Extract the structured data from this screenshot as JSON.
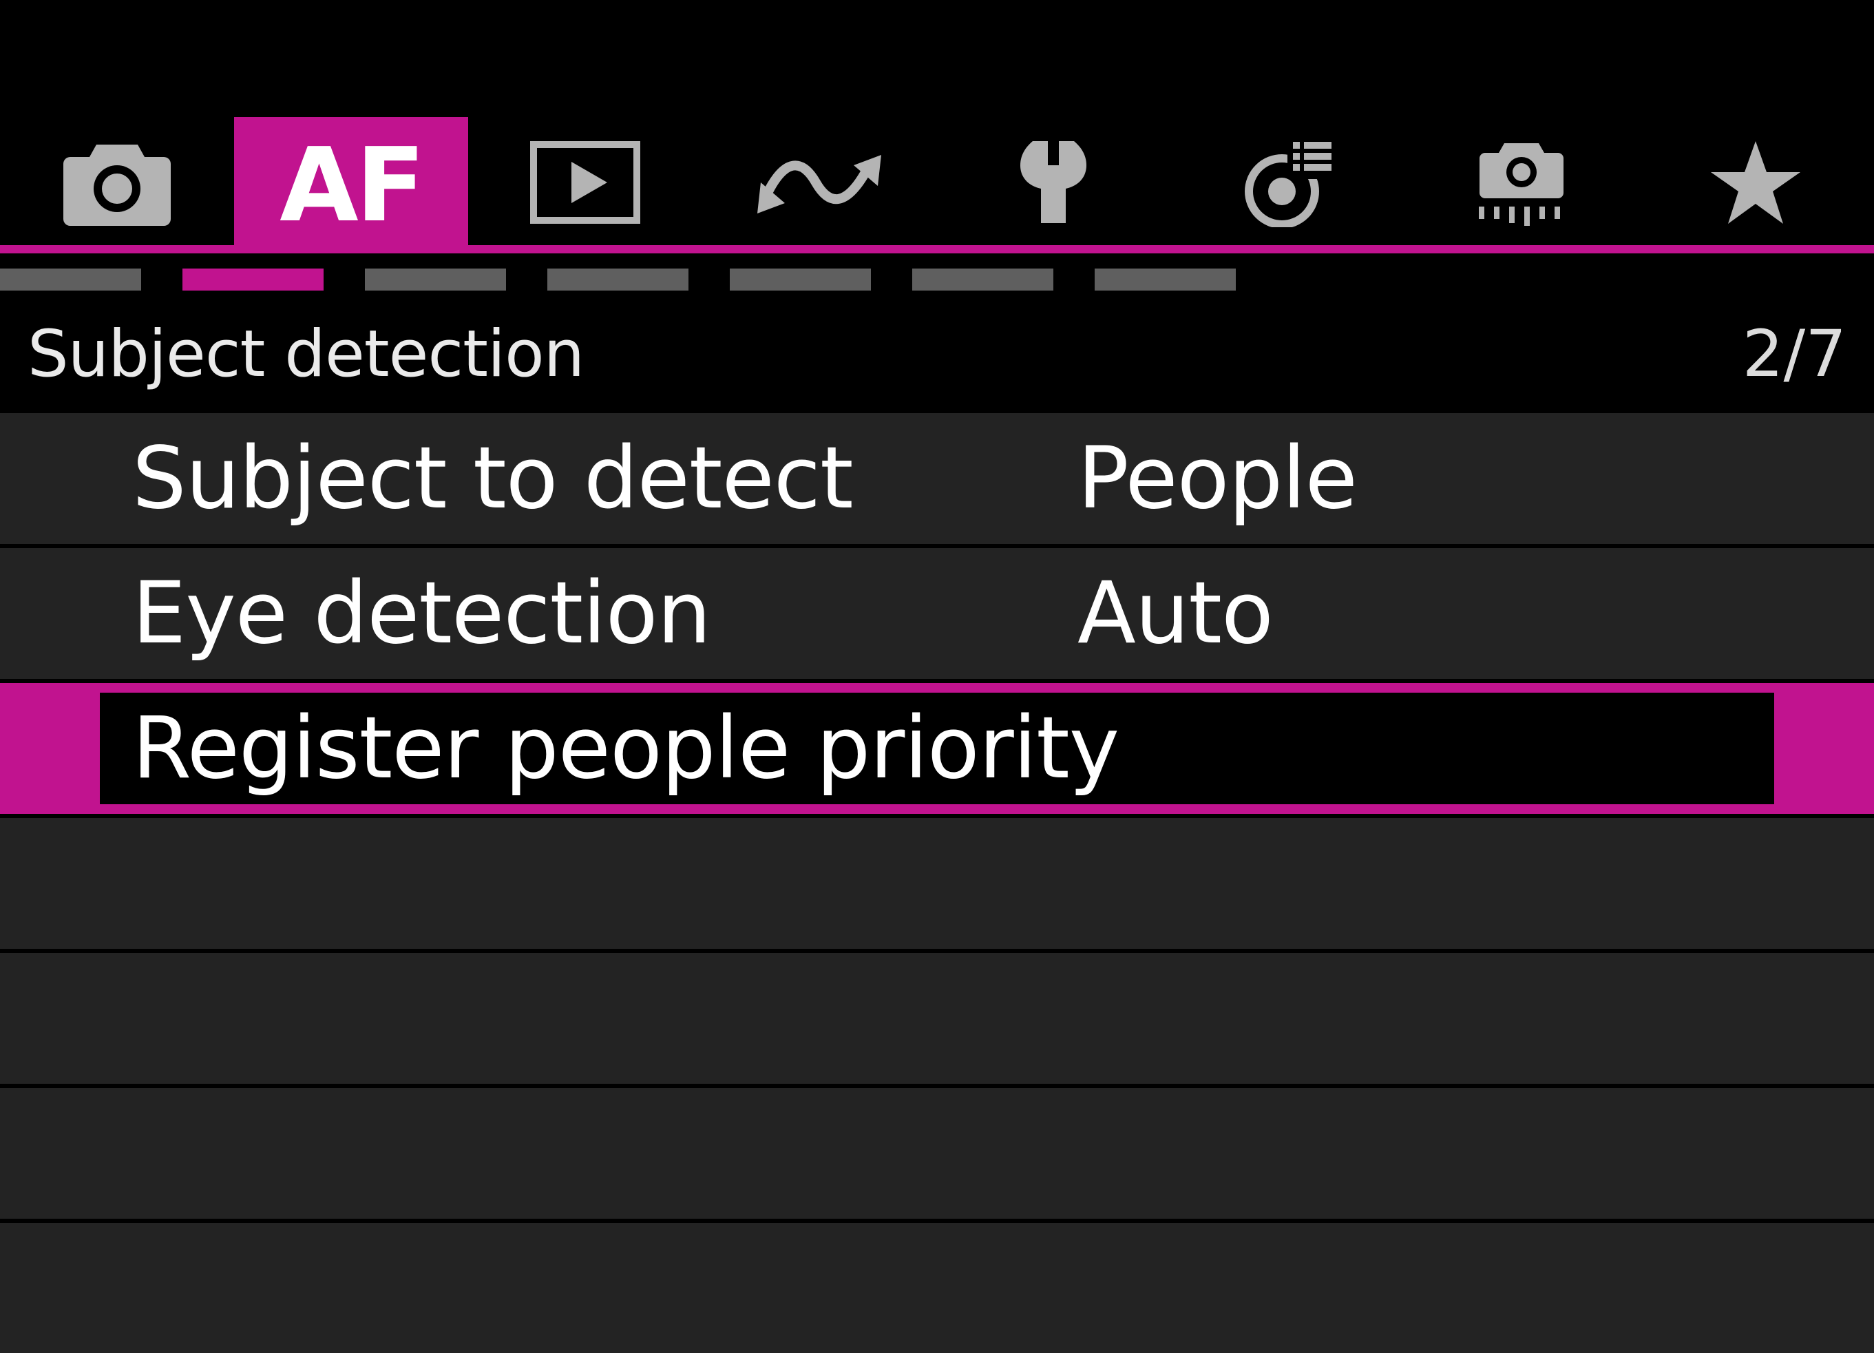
{
  "colors": {
    "accent": "#c1138f",
    "icon_inactive": "#b4b4b4",
    "row_bg": "#232323",
    "page_inactive": "#5f5f5f"
  },
  "tabs": [
    {
      "icon": "camera-icon",
      "active": false
    },
    {
      "icon": "af-label",
      "label": "AF",
      "active": true
    },
    {
      "icon": "playback-icon",
      "active": false
    },
    {
      "icon": "wireless-icon",
      "active": false
    },
    {
      "icon": "wrench-icon",
      "active": false
    },
    {
      "icon": "custom-functions-icon",
      "active": false
    },
    {
      "icon": "camera-custom-icon",
      "active": false
    },
    {
      "icon": "star-icon",
      "active": false
    }
  ],
  "page_indicator": {
    "count": 7,
    "active_index": 1
  },
  "header": {
    "title": "Subject detection",
    "page_counter": "2/7"
  },
  "menu": {
    "rows": [
      {
        "label": "Subject to detect",
        "value": "People",
        "selected": false
      },
      {
        "label": "Eye detection",
        "value": "Auto",
        "selected": false
      },
      {
        "label": "Register people priority",
        "value": "",
        "selected": true
      },
      {
        "label": "",
        "value": "",
        "selected": false
      },
      {
        "label": "",
        "value": "",
        "selected": false
      },
      {
        "label": "",
        "value": "",
        "selected": false
      },
      {
        "label": "",
        "value": "",
        "selected": false
      }
    ]
  }
}
